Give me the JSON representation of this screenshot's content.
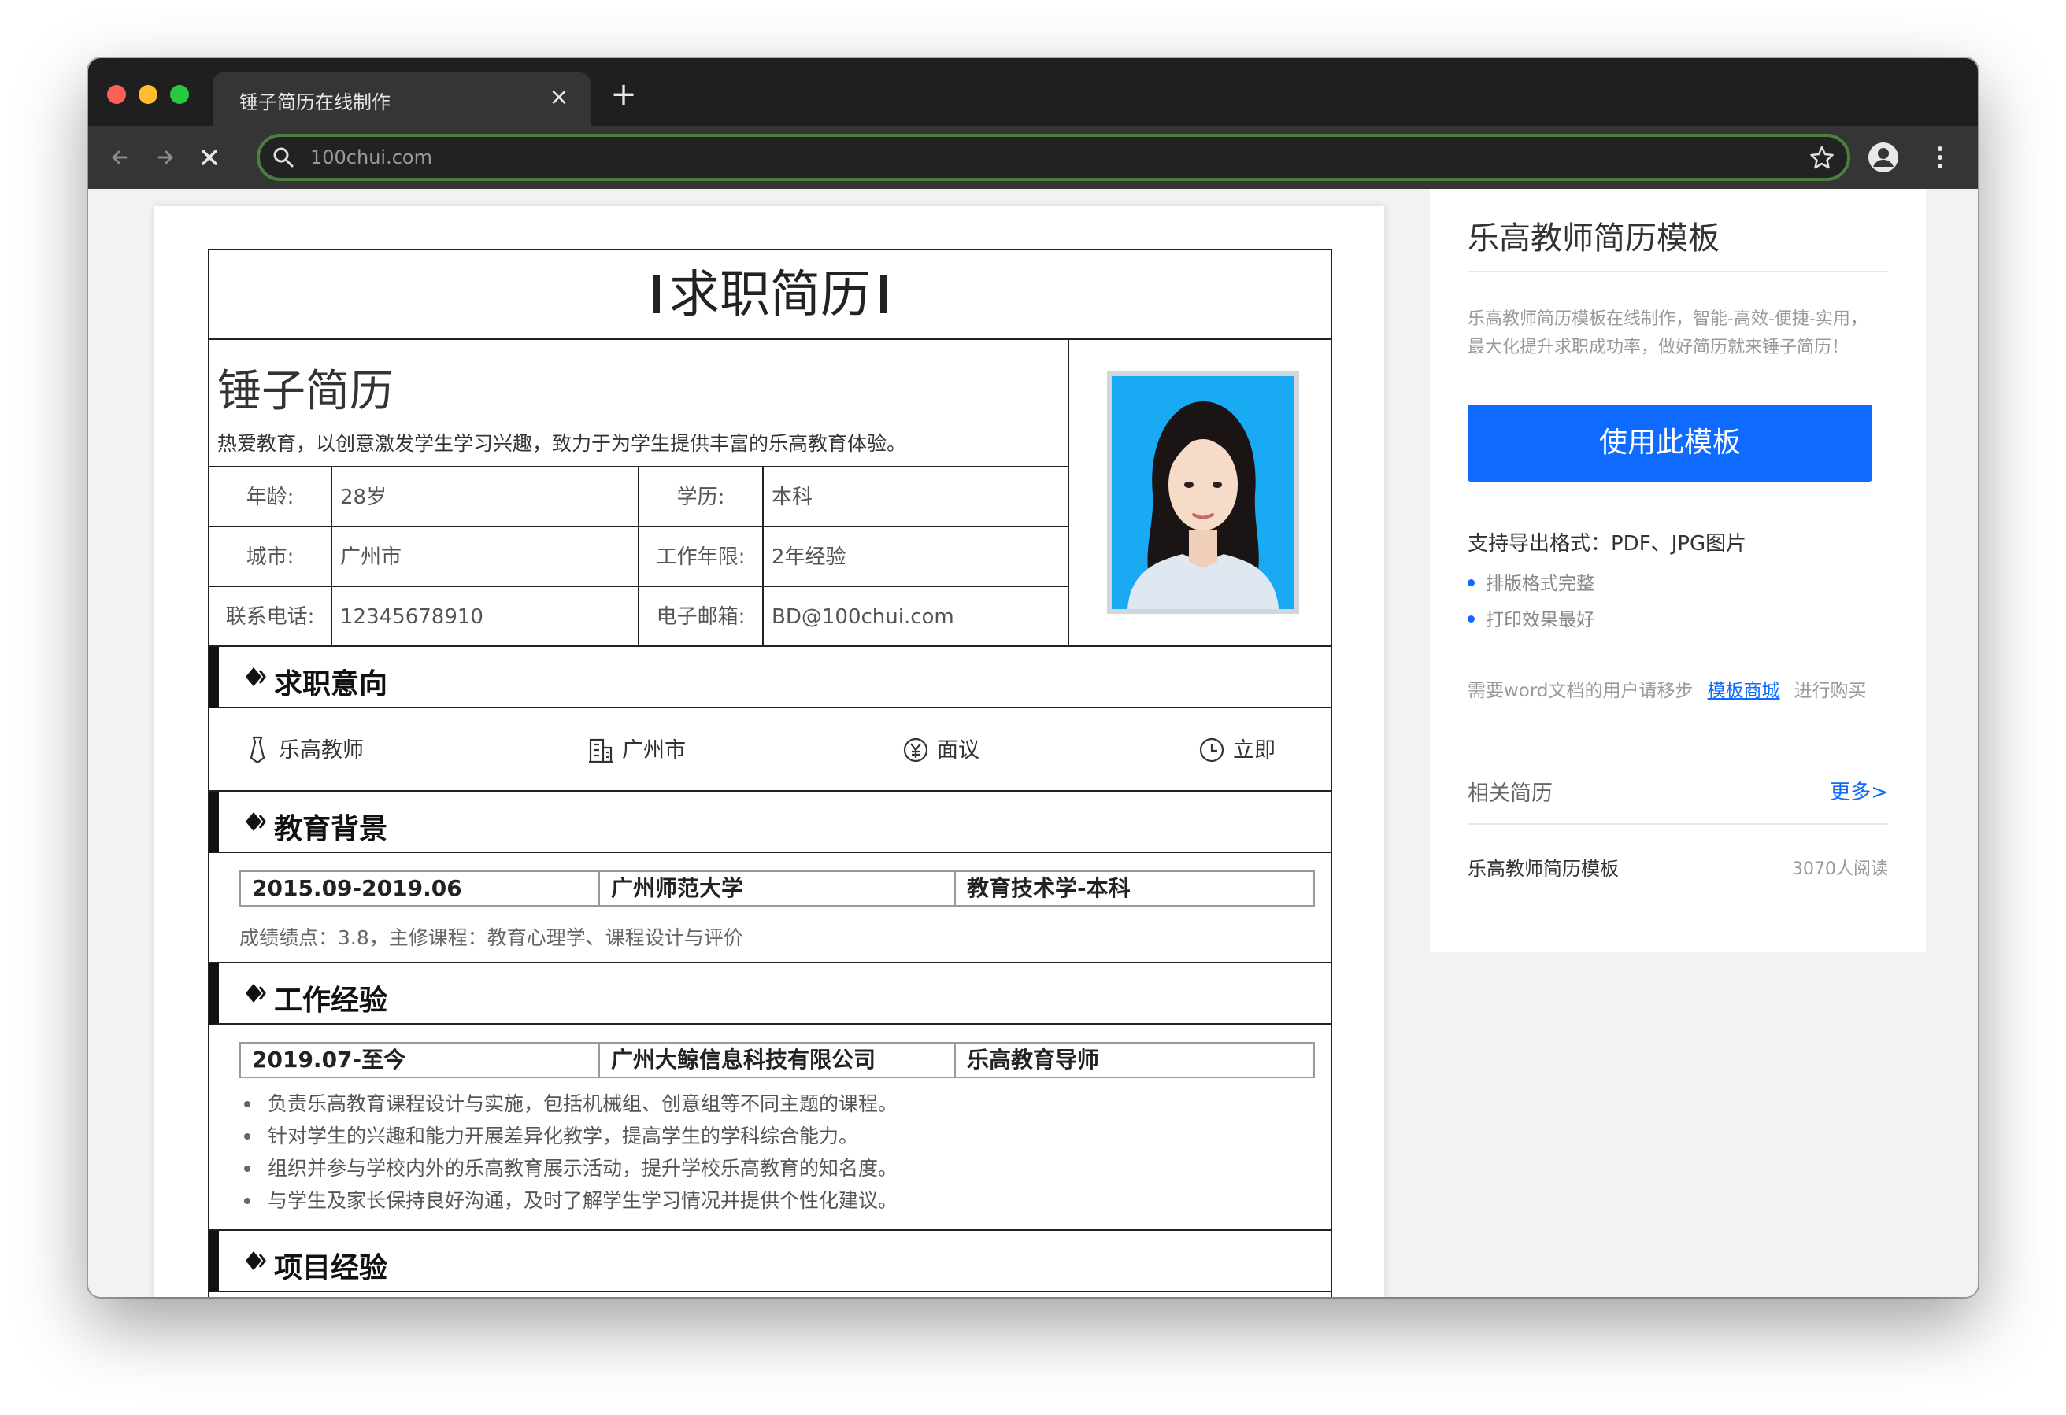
{
  "browser": {
    "tab_title": "锤子简历在线制作",
    "tab_close": "×",
    "new_tab": "+",
    "url": "100chui.com"
  },
  "resume": {
    "title": "求职简历",
    "name": "锤子简历",
    "motto": "热爱教育，以创意激发学生学习兴趣，致力于为学生提供丰富的乐高教育体验。",
    "info": [
      {
        "l1": "年龄:",
        "v1": "28岁",
        "l2": "学历:",
        "v2": "本科"
      },
      {
        "l1": "城市:",
        "v1": "广州市",
        "l2": "工作年限:",
        "v2": "2年经验"
      },
      {
        "l1": "联系电话:",
        "v1": "12345678910",
        "l2": "电子邮箱:",
        "v2": "BD@100chui.com"
      }
    ],
    "sections": {
      "intent": "求职意向",
      "education": "教育背景",
      "work": "工作经验",
      "project": "项目经验"
    },
    "intent": {
      "position": "乐高教师",
      "city": "广州市",
      "salary": "面议",
      "availability": "立即"
    },
    "education": {
      "period": "2015.09-2019.06",
      "school": "广州师范大学",
      "major": "教育技术学-本科",
      "desc": "成绩绩点：3.8，主修课程：教育心理学、课程设计与评价"
    },
    "work": {
      "period": "2019.07-至今",
      "company": "广州大鲸信息科技有限公司",
      "role": "乐高教育导师",
      "bullets": [
        "负责乐高教育课程设计与实施，包括机械组、创意组等不同主题的课程。",
        "针对学生的兴趣和能力开展差异化教学，提高学生的学科综合能力。",
        "组织并参与学校内外的乐高教育展示活动，提升学校乐高教育的知名度。",
        "与学生及家长保持良好沟通，及时了解学生学习情况并提供个性化建议。"
      ]
    }
  },
  "sidebar": {
    "title": "乐高教师简历模板",
    "desc_line1": "乐高教师简历模板在线制作，智能-高效-便捷-实用，",
    "desc_line2": "最大化提升求职成功率，做好简历就来锤子简历！",
    "use_button": "使用此模板",
    "export_formats": "支持导出格式：PDF、JPG图片",
    "features": [
      "排版格式完整",
      "打印效果最好"
    ],
    "word_prefix": "需要word文档的用户请移步",
    "word_link": "模板商城",
    "word_suffix": "进行购买",
    "related_title": "相关简历",
    "more": "更多>",
    "related_item": "乐高教师简历模板",
    "related_reads": "3070人阅读"
  },
  "colors": {
    "accent": "#0f6aff",
    "chrome_dark": "#1f1f1f",
    "chrome_toolbar": "#353535",
    "omnibox_border": "#4a7f3d",
    "photo_bg": "#18a8f2"
  }
}
